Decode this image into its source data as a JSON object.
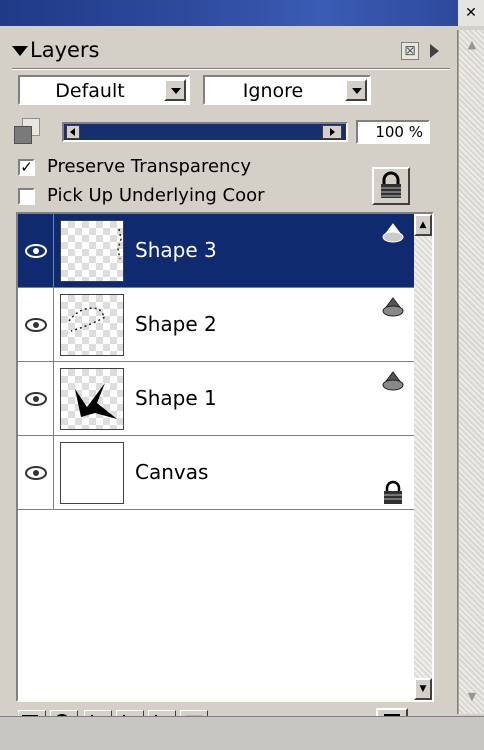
{
  "panel": {
    "title": "Layers",
    "close_glyph": "⊠",
    "blend_mode": "Default",
    "mask_mode": "Ignore",
    "opacity_value": 100,
    "opacity_label": "100 %",
    "preserve_transparency": {
      "label": "Preserve Transparency",
      "checked": true
    },
    "pick_up_color": {
      "label": "Pick Up Underlying Coor",
      "checked": false
    }
  },
  "layers": [
    {
      "name": "Shape 3",
      "selected": true,
      "visible": true,
      "type_icon": "object-shape-icon"
    },
    {
      "name": "Shape 2",
      "selected": false,
      "visible": true,
      "type_icon": "object-shape-icon"
    },
    {
      "name": "Shape 1",
      "selected": false,
      "visible": true,
      "type_icon": "object-shape-icon"
    },
    {
      "name": "Canvas",
      "selected": false,
      "visible": true,
      "type_icon": "lock-icon"
    }
  ],
  "toolbar_icons": [
    "layer-options-icon",
    "group-layer-icon",
    "new-layer-icon",
    "new-raster-icon",
    "new-vector-icon",
    "disabled-layer-icon",
    "trash-icon"
  ],
  "colors": {
    "selection": "#0f2a6e",
    "panel_bg": "#d4d0c8",
    "slider_fill": "#17306d"
  }
}
